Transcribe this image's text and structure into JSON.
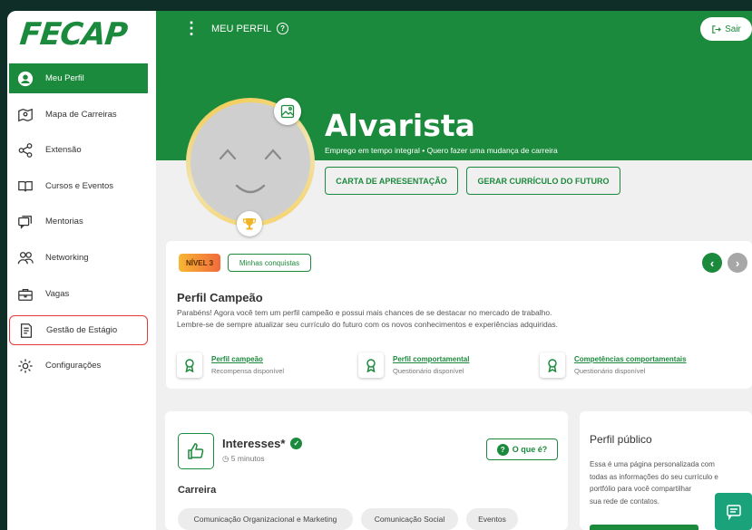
{
  "brand": {
    "logo": "FECAP"
  },
  "sidebar": {
    "items": [
      {
        "label": "Meu Perfil",
        "icon": "user-circle-icon"
      },
      {
        "label": "Mapa de Carreiras",
        "icon": "map-icon"
      },
      {
        "label": "Extensão",
        "icon": "share-icon"
      },
      {
        "label": "Cursos e Eventos",
        "icon": "book-icon"
      },
      {
        "label": "Mentorias",
        "icon": "chat-icon"
      },
      {
        "label": "Networking",
        "icon": "people-icon"
      },
      {
        "label": "Vagas",
        "icon": "briefcase-icon"
      },
      {
        "label": "Gestão de Estágio",
        "icon": "document-icon"
      },
      {
        "label": "Configurações",
        "icon": "gear-icon"
      }
    ]
  },
  "header": {
    "title": "MEU PERFIL",
    "help": "?",
    "logout": "Sair"
  },
  "profile": {
    "name": "Alvarista",
    "subtitle": "Emprego em tempo integral •  Quero fazer uma mudança de carreira",
    "btn_cover_letter": "CARTA DE APRESENTAÇÃO",
    "btn_resume": "GERAR CURRÍCULO DO FUTURO"
  },
  "level": {
    "badge": "NÍVEL 3",
    "achievements": "Minhas conquistas",
    "title": "Perfil Campeão",
    "text_line1": "Parabéns! Agora você tem um perfil campeão e possui mais chances de se destacar no mercado de trabalho.",
    "text_line2": "Lembre-se de sempre atualizar seu currículo do futuro com os novos conhecimentos e experiências adquiridas.",
    "items": [
      {
        "title": "Perfil campeão",
        "sub": "Recompensa disponível"
      },
      {
        "title": "Perfil comportamental",
        "sub": "Questionário disponível"
      },
      {
        "title": "Competências comportamentais",
        "sub": "Questionário disponível"
      }
    ]
  },
  "interests": {
    "title": "Interesses*",
    "time": "5 minutos",
    "what_btn": "O que é?",
    "q": "?",
    "section": "Carreira",
    "chips": [
      "Comunicação Organizacional e Marketing",
      "Comunicação Social",
      "Eventos"
    ]
  },
  "public_profile": {
    "title": "Perfil público",
    "text_lines": [
      "Essa é uma página personalizada com",
      "todas as informações do seu currículo e",
      "portfólio para você compartilhar",
      "sua rede de contatos."
    ]
  },
  "colors": {
    "brand_green": "#1b8a3c",
    "chat_teal": "#1aa37a",
    "level_gradient_start": "#f7b733"
  }
}
